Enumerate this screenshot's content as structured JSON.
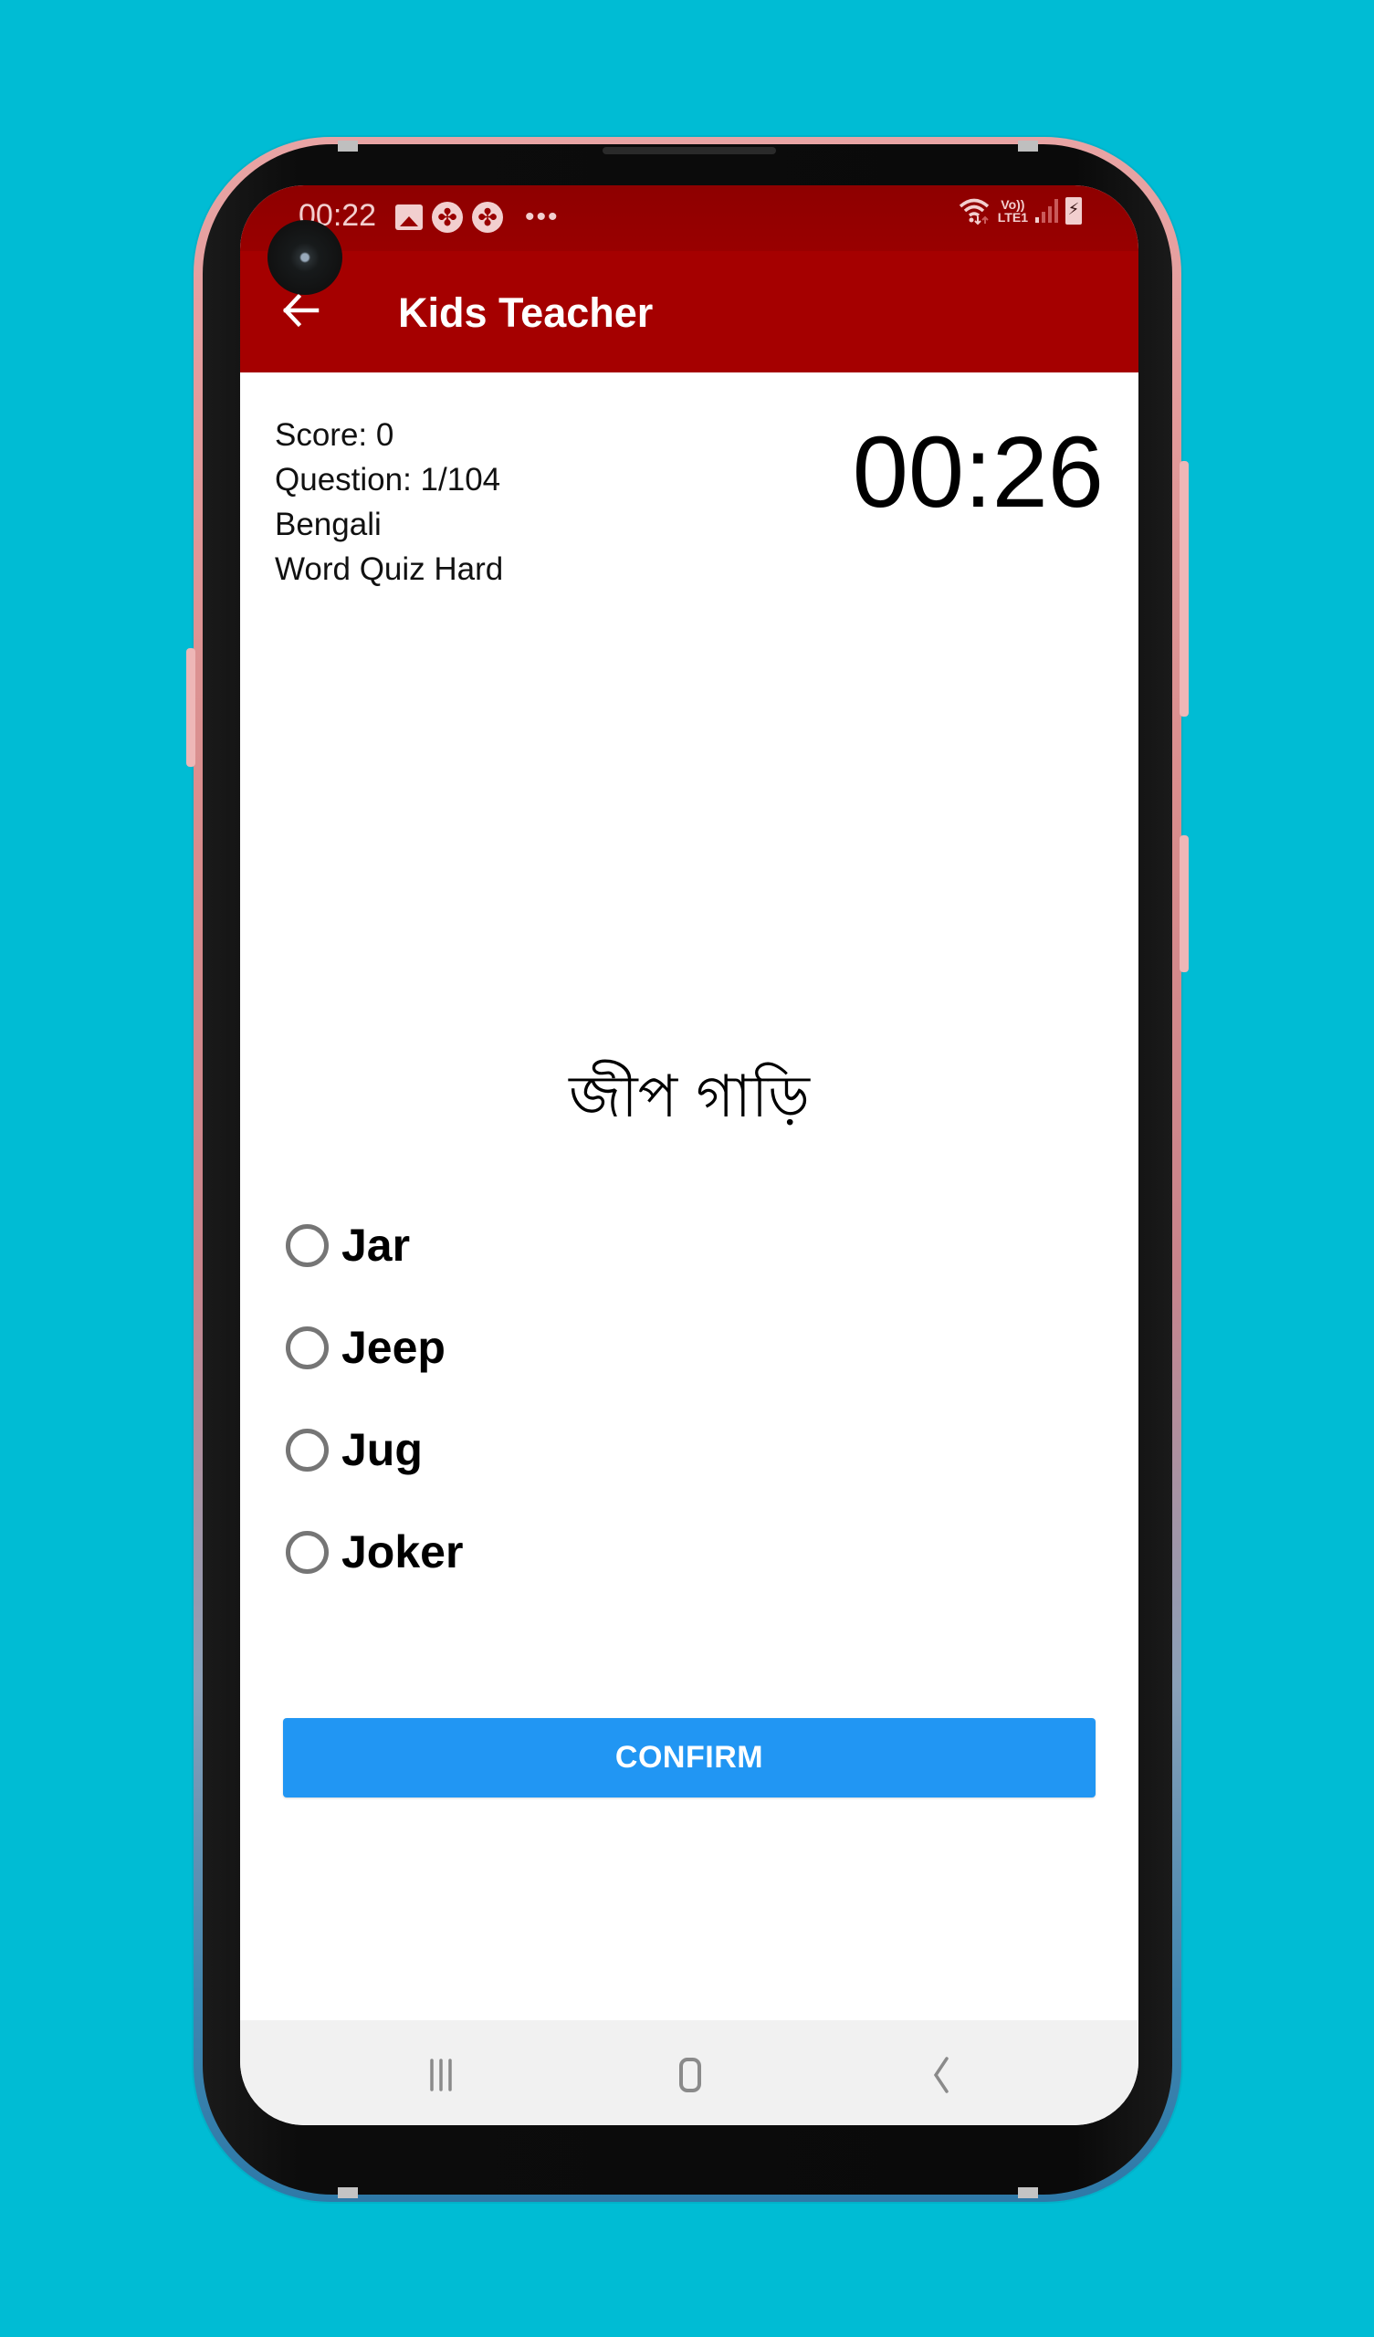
{
  "status_bar": {
    "time": "00:22",
    "left_icons": [
      "gallery-icon",
      "app-notification-icon",
      "app-notification-icon",
      "more-notifications-icon"
    ],
    "right_icons": [
      "wifi-icon",
      "volte-lte-icon",
      "signal-icon",
      "battery-charging-icon"
    ],
    "volte_line1": "Vo))",
    "volte_line2": "LTE1"
  },
  "app_bar": {
    "title": "Kids Teacher",
    "back_icon": "arrow-left-icon",
    "background_color": "#A50000"
  },
  "quiz": {
    "score_label": "Score: 0",
    "question_label": "Question: 1/104",
    "language": "Bengali",
    "mode": "Word Quiz Hard",
    "timer": "00:26",
    "question_word": "জীপ গাড়ি",
    "options": [
      {
        "label": "Jar",
        "selected": false
      },
      {
        "label": "Jeep",
        "selected": false
      },
      {
        "label": "Jug",
        "selected": false
      },
      {
        "label": "Joker",
        "selected": false
      }
    ],
    "confirm_label": "CONFIRM",
    "confirm_color": "#2196F3"
  },
  "nav_bar": {
    "buttons": [
      "recent-apps-icon",
      "home-icon",
      "back-icon"
    ]
  }
}
